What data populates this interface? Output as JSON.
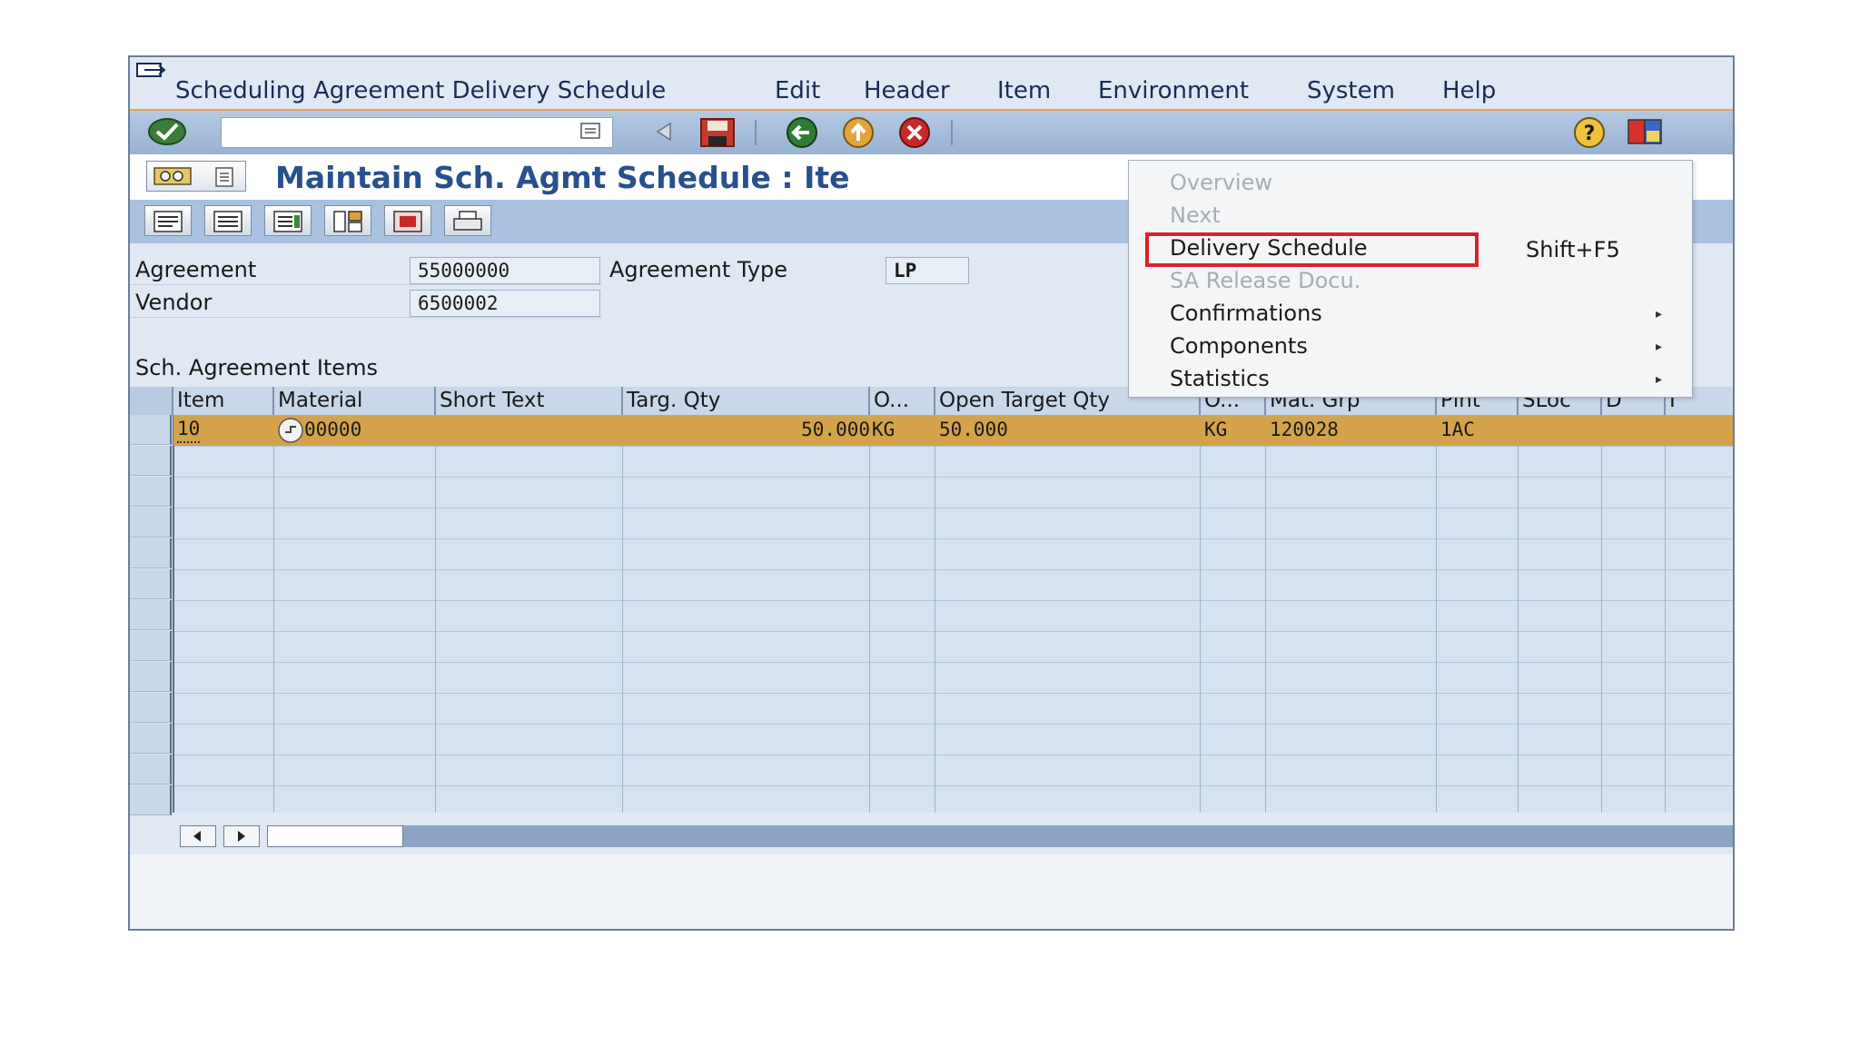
{
  "menu": {
    "items": [
      "Scheduling Agreement Delivery Schedule",
      "Edit",
      "Header",
      "Item",
      "Environment",
      "System",
      "Help"
    ]
  },
  "title": "Maintain Sch. Agmt Schedule : Ite",
  "header": {
    "agreement_label": "Agreement",
    "agreement_value": "55000000",
    "agreement_type_label": "Agreement Type",
    "agreement_type_value": "LP",
    "vendor_label": "Vendor",
    "vendor_value": "6500002"
  },
  "items_section_label": "Sch. Agreement Items",
  "table": {
    "columns": [
      "Item",
      "Material",
      "Short Text",
      "Targ. Qty",
      "O...",
      "Open Target Qty",
      "O...",
      "Mat. Grp",
      "Plnt",
      "SLoc",
      "D",
      "I"
    ],
    "row": {
      "item": "10",
      "material": "00000",
      "short_text": "",
      "targ_qty": "50.000",
      "unit1": "KG",
      "open_target_qty": "50.000",
      "unit2": "KG",
      "mat_grp": "120028",
      "plnt": "1AC"
    }
  },
  "dropdown": {
    "items": [
      {
        "label": "Overview",
        "disabled": true
      },
      {
        "label": "Next",
        "disabled": true
      },
      {
        "label": "Delivery Schedule",
        "disabled": false,
        "shortcut": "Shift+F5"
      },
      {
        "label": "SA Release Docu.",
        "disabled": true
      },
      {
        "label": "Confirmations",
        "disabled": false,
        "submenu": true
      },
      {
        "label": "Components",
        "disabled": false,
        "submenu": true
      },
      {
        "label": "Statistics",
        "disabled": false,
        "submenu": true
      }
    ],
    "highlight_color": "#d8232a"
  },
  "colors": {
    "selected_row": "#d4a24a",
    "title": "#28508c",
    "toolbar_accent": "#e7a35b"
  }
}
